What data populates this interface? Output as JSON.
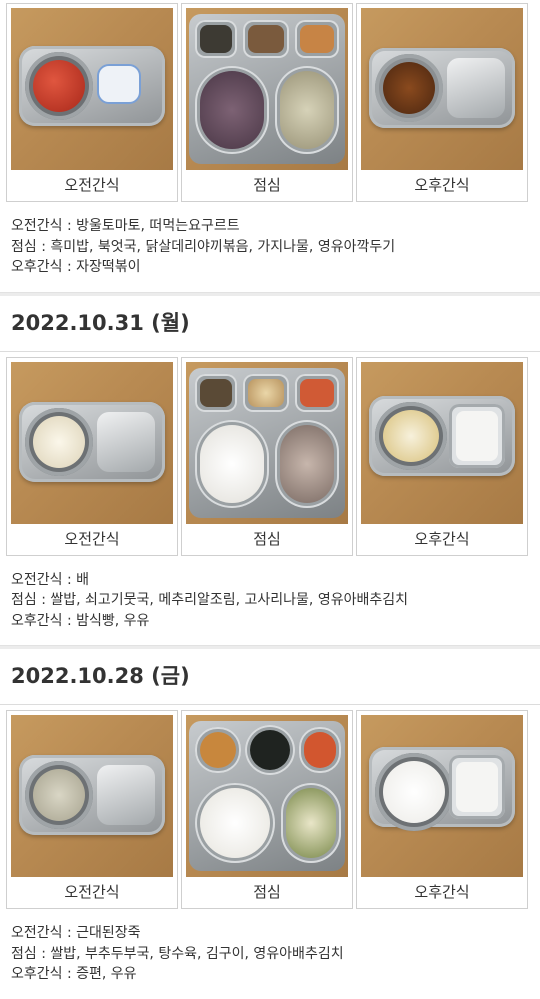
{
  "captions": {
    "morning": "오전간식",
    "lunch": "점심",
    "afternoon": "오후간식"
  },
  "days": [
    {
      "date": "",
      "menu": {
        "morning": "오전간식 : 방울토마토, 떠먹는요구르트",
        "lunch": "점심 : 흑미밥, 북엇국, 닭살데리야끼볶음, 가지나물, 영유아깍두기",
        "afternoon": "오후간식 : 자장떡볶이"
      }
    },
    {
      "date": "2022.10.31 (월)",
      "menu": {
        "morning": "오전간식 : 배",
        "lunch": "점심 : 쌀밥, 쇠고기뭇국, 메추리알조림, 고사리나물, 영유아배추김치",
        "afternoon": "오후간식 : 밤식빵, 우유"
      }
    },
    {
      "date": "2022.10.28 (금)",
      "menu": {
        "morning": "오전간식 : 근대된장죽",
        "lunch": "점심 : 쌀밥, 부추두부국, 탕수육, 김구이, 영유아배추김치",
        "afternoon": "오후간식 : 증편, 우유"
      }
    }
  ],
  "colors": {
    "table": "#b98b54",
    "tray": "#a4a9ac",
    "header_text": "#333333",
    "border": "#cfcfcf"
  }
}
